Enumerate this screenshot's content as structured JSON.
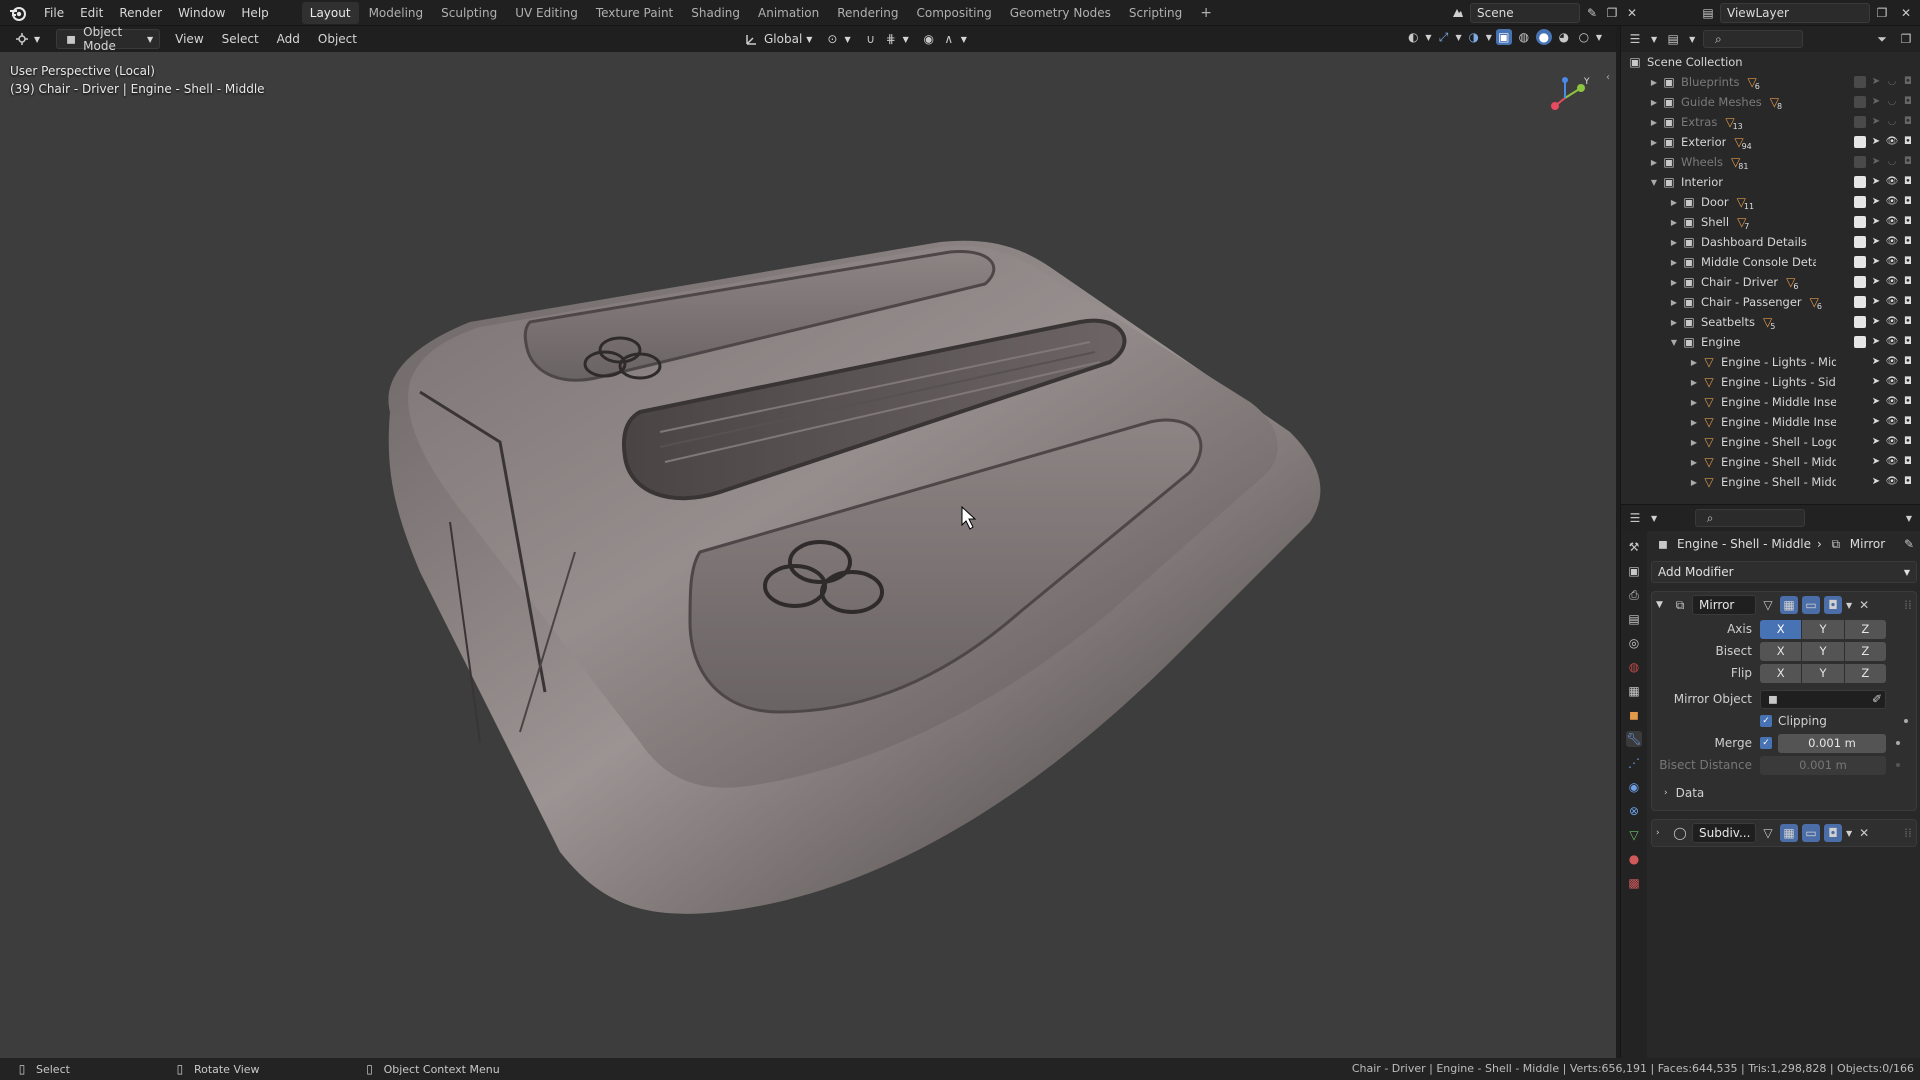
{
  "app": {
    "name": "Blender"
  },
  "topbar": {
    "menus": [
      "File",
      "Edit",
      "Render",
      "Window",
      "Help"
    ],
    "workspaces": [
      "Layout",
      "Modeling",
      "Sculpting",
      "UV Editing",
      "Texture Paint",
      "Shading",
      "Animation",
      "Rendering",
      "Compositing",
      "Geometry Nodes",
      "Scripting"
    ],
    "active_workspace": "Layout",
    "scene": "Scene",
    "view_layer": "ViewLayer"
  },
  "viewport_header": {
    "mode": "Object Mode",
    "menus": [
      "View",
      "Select",
      "Add",
      "Object"
    ],
    "orientation": "Global"
  },
  "viewport": {
    "perspective": "User Perspective (Local)",
    "active_info": "(39) Chair - Driver | Engine - Shell - Middle",
    "gizmo_axes": [
      "Y",
      "X",
      "Z"
    ]
  },
  "outliner": {
    "root": "Scene Collection",
    "items": [
      {
        "label": "Blueprints",
        "depth": 1,
        "expanded": false,
        "dim": true,
        "count": "6"
      },
      {
        "label": "Guide Meshes",
        "depth": 1,
        "expanded": false,
        "dim": true,
        "count": "8"
      },
      {
        "label": "Extras",
        "depth": 1,
        "expanded": false,
        "dim": true,
        "count": "13"
      },
      {
        "label": "Exterior",
        "depth": 1,
        "expanded": false,
        "dim": false,
        "count": "94"
      },
      {
        "label": "Wheels",
        "depth": 1,
        "expanded": false,
        "dim": true,
        "count": "81"
      },
      {
        "label": "Interior",
        "depth": 1,
        "expanded": true,
        "dim": false,
        "count": ""
      },
      {
        "label": "Door",
        "depth": 2,
        "expanded": false,
        "dim": false,
        "count": "11"
      },
      {
        "label": "Shell",
        "depth": 2,
        "expanded": false,
        "dim": false,
        "count": "7"
      },
      {
        "label": "Dashboard Details",
        "depth": 2,
        "expanded": false,
        "dim": false,
        "count": ""
      },
      {
        "label": "Middle Console Details",
        "depth": 2,
        "expanded": false,
        "dim": false,
        "count": ""
      },
      {
        "label": "Chair - Driver",
        "depth": 2,
        "expanded": false,
        "dim": false,
        "count": "6"
      },
      {
        "label": "Chair - Passenger",
        "depth": 2,
        "expanded": false,
        "dim": false,
        "count": "6"
      },
      {
        "label": "Seatbelts",
        "depth": 2,
        "expanded": false,
        "dim": false,
        "count": "5"
      },
      {
        "label": "Engine",
        "depth": 2,
        "expanded": true,
        "dim": false,
        "count": ""
      },
      {
        "label": "Engine - Lights - Middl",
        "depth": 3,
        "expanded": false,
        "dim": false,
        "count": ""
      },
      {
        "label": "Engine - Lights - Side",
        "depth": 3,
        "expanded": false,
        "dim": false,
        "count": ""
      },
      {
        "label": "Engine - Middle Insert",
        "depth": 3,
        "expanded": false,
        "dim": false,
        "count": ""
      },
      {
        "label": "Engine - Middle Insert",
        "depth": 3,
        "expanded": false,
        "dim": false,
        "count": ""
      },
      {
        "label": "Engine - Shell - Logos",
        "depth": 3,
        "expanded": false,
        "dim": false,
        "count": ""
      },
      {
        "label": "Engine - Shell - Middle",
        "depth": 3,
        "expanded": false,
        "dim": false,
        "count": ""
      },
      {
        "label": "Engine - Shell - Middle",
        "depth": 3,
        "expanded": false,
        "dim": false,
        "count": ""
      }
    ]
  },
  "properties": {
    "breadcrumb_object": "Engine - Shell - Middle",
    "breadcrumb_modifier": "Mirror",
    "add_modifier": "Add Modifier",
    "mirror": {
      "name": "Mirror",
      "axis_label": "Axis",
      "bisect_label": "Bisect",
      "flip_label": "Flip",
      "axes": [
        "X",
        "Y",
        "Z"
      ],
      "axis_enabled": [
        true,
        false,
        false
      ],
      "mirror_object_label": "Mirror Object",
      "clipping_label": "Clipping",
      "clipping": true,
      "merge_label": "Merge",
      "merge_value": "0.001 m",
      "bisect_distance_label": "Bisect Distance",
      "bisect_distance_value": "0.001 m",
      "data_label": "Data"
    },
    "subdiv": {
      "name": "Subdiv..."
    }
  },
  "statusbar": {
    "select": "Select",
    "rotate": "Rotate View",
    "context_menu": "Object Context Menu",
    "stats": "Chair - Driver | Engine - Shell - Middle | Verts:656,191 | Faces:644,535 | Tris:1,298,828 | Objects:0/166"
  },
  "colors": {
    "accent": "#4772b3",
    "mesh_icon": "#e39a4a",
    "viewport_bg": "#3d3d3d"
  }
}
